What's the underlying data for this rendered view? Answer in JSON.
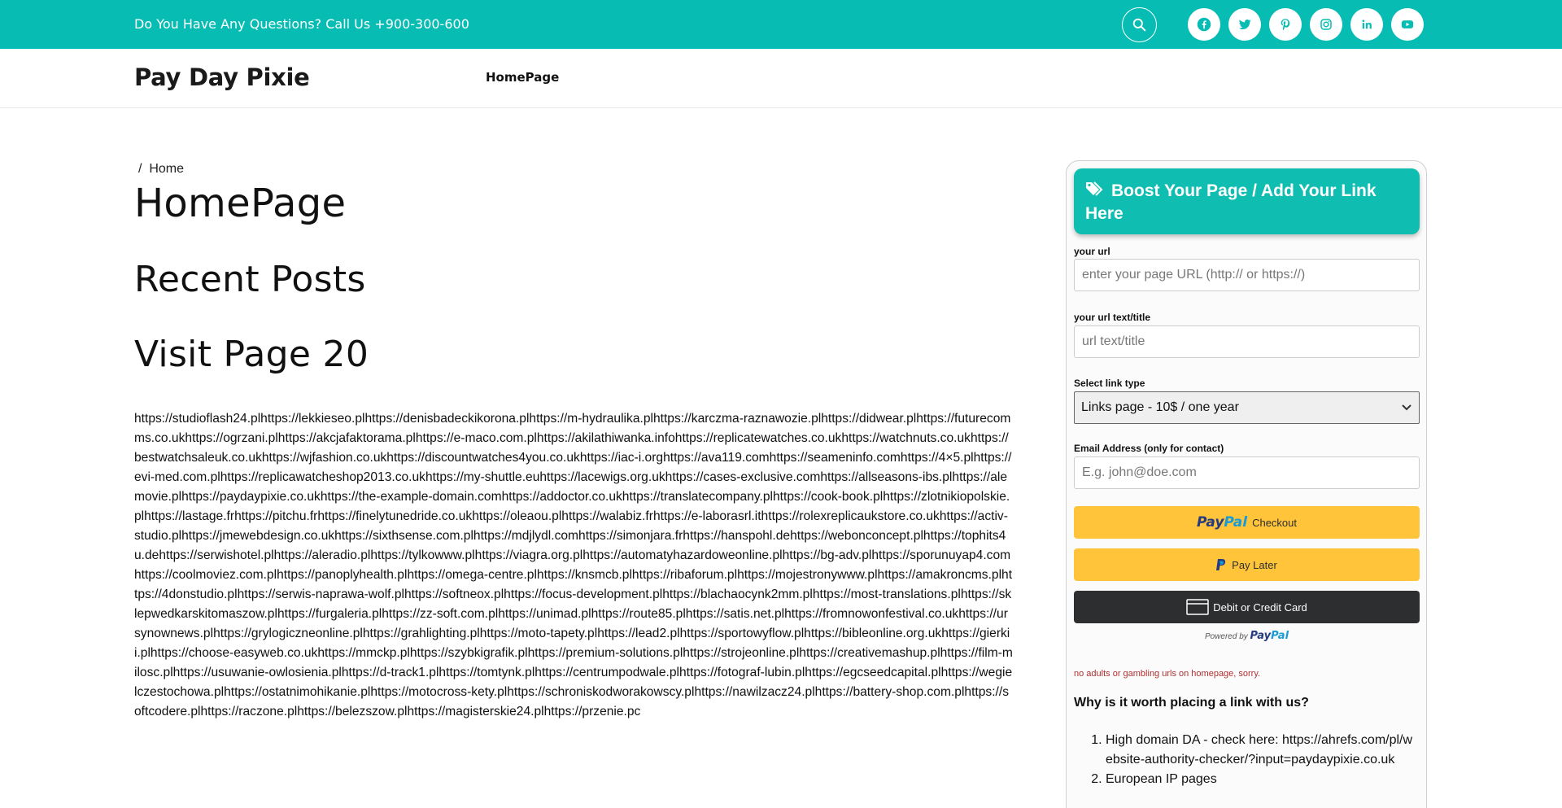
{
  "topbar": {
    "contact_text": "Do You Have Any Questions? Call Us +900-300-600",
    "social_icons": [
      "facebook-icon",
      "twitter-icon",
      "pinterest-icon",
      "instagram-icon",
      "linkedin-icon",
      "youtube-icon"
    ]
  },
  "header": {
    "site_title": "Pay Day Pixie",
    "nav_home": "HomePage"
  },
  "main": {
    "breadcrumb_sep": "/",
    "breadcrumb_home": "Home",
    "page_title": "HomePage",
    "recent_posts": "Recent Posts",
    "visit_page": "Visit Page 20",
    "url_text": "https://studioflash24.plhttps://lekkieseo.plhttps://denisbadeckikorona.plhttps://m-hydraulika.plhttps://karczma-raznawozie.plhttps://didwear.plhttps://futurecomms.co.ukhttps://ogrzani.plhttps://akcjafaktorama.plhttps://e-maco.com.plhttps://akilathiwanka.infohttps://replicatewatches.co.ukhttps://watchnuts.co.ukhttps://bestwatchsaleuk.co.ukhttps://wjfashion.co.ukhttps://discountwatches4you.co.ukhttps://iac-i.orghttps://ava119.comhttps://seameninfo.comhttps://4×5.plhttps://evi-med.com.plhttps://replicawatcheshop2013.co.ukhttps://my-shuttle.euhttps://lacewigs.org.ukhttps://cases-exclusive.comhttps://allseasons-ibs.plhttps://alemovie.plhttps://paydaypixie.co.ukhttps://the-example-domain.comhttps://addoctor.co.ukhttps://translatecompany.plhttps://cook-book.plhttps://zlotnikiopolskie.plhttps://lastage.frhttps://pitchu.frhttps://finelytunedride.co.ukhttps://oleaou.plhttps://walabiz.frhttps://e-laborasrl.ithttps://rolexreplicaukstore.co.ukhttps://activ-studio.plhttps://jmewebdesign.co.ukhttps://sixthsense.com.plhttps://mdjlydl.comhttps://simonjara.frhttps://hanspohl.dehttps://webonconcept.plhttps://tophits4u.dehttps://serwishotel.plhttps://aleradio.plhttps://tylkowww.plhttps://viagra.org.plhttps://automatyhazardoweonline.plhttps://bg-adv.plhttps://sporunuyap4.comhttps://coolmoviez.com.plhttps://panoplyhealth.plhttps://omega-centre.plhttps://knsmcb.plhttps://ribaforum.plhttps://mojestronywww.plhttps://amakroncms.plhttps://4donstudio.plhttps://serwis-naprawa-wolf.plhttps://softneox.plhttps://focus-development.plhttps://blachaocynk2mm.plhttps://most-translations.plhttps://sklepwedkarskitomaszow.plhttps://furgaleria.plhttps://zz-soft.com.plhttps://unimad.plhttps://route85.plhttps://satis.net.plhttps://fromnowonfestival.co.ukhttps://ursynownews.plhttps://grylogiczneonline.plhttps://grahlighting.plhttps://moto-tapety.plhttps://lead2.plhttps://sportowyflow.plhttps://bibleonline.org.ukhttps://gierkii.plhttps://choose-easyweb.co.ukhttps://mmckp.plhttps://szybkigrafik.plhttps://premium-solutions.plhttps://strojeonline.plhttps://creativemashup.plhttps://film-milosc.plhttps://usuwanie-owlosienia.plhttps://d-track1.plhttps://tomtynk.plhttps://centrumpodwale.plhttps://fotograf-lubin.plhttps://egcseedcapital.plhttps://wegielczestochowa.plhttps://ostatnimohikanie.plhttps://motocross-kety.plhttps://schroniskodworakowscy.plhttps://nawilzacz24.plhttps://battery-shop.com.plhttps://softcodere.plhttps://raczone.plhttps://belezszow.plhttps://magisterskie24.plhttps://przenie.pc"
  },
  "sidebar": {
    "boost_title": "Boost Your Page / Add Your Link Here",
    "url_label": "your url",
    "url_placeholder": "enter your page URL (http:// or https://)",
    "title_label": "your url text/title",
    "title_placeholder": "url text/title",
    "link_type_label": "Select link type",
    "link_type_value": "Links page - 10$ / one year",
    "email_label": "Email Address (only for contact)",
    "email_placeholder": "E.g. john@doe.com",
    "checkout_label": "Checkout",
    "paylater_label": "Pay Later",
    "card_label": "Debit or Credit Card",
    "powered_by": "Powered by",
    "paypal_pay": "Pay",
    "paypal_pal": "Pal",
    "warning": "no adults or gambling urls on homepage, sorry.",
    "why_title": "Why is it worth placing a link with us?",
    "reasons": [
      "High domain DA - check here: https://ahrefs.com/pl/website-authority-checker/?input=paydaypixie.co.uk",
      "European IP pages"
    ]
  },
  "colors": {
    "accent": "#07bcb3",
    "paypal_yellow": "#ffc439",
    "paypal_dark": "#2c2e2f",
    "warning_red": "#b03030"
  }
}
